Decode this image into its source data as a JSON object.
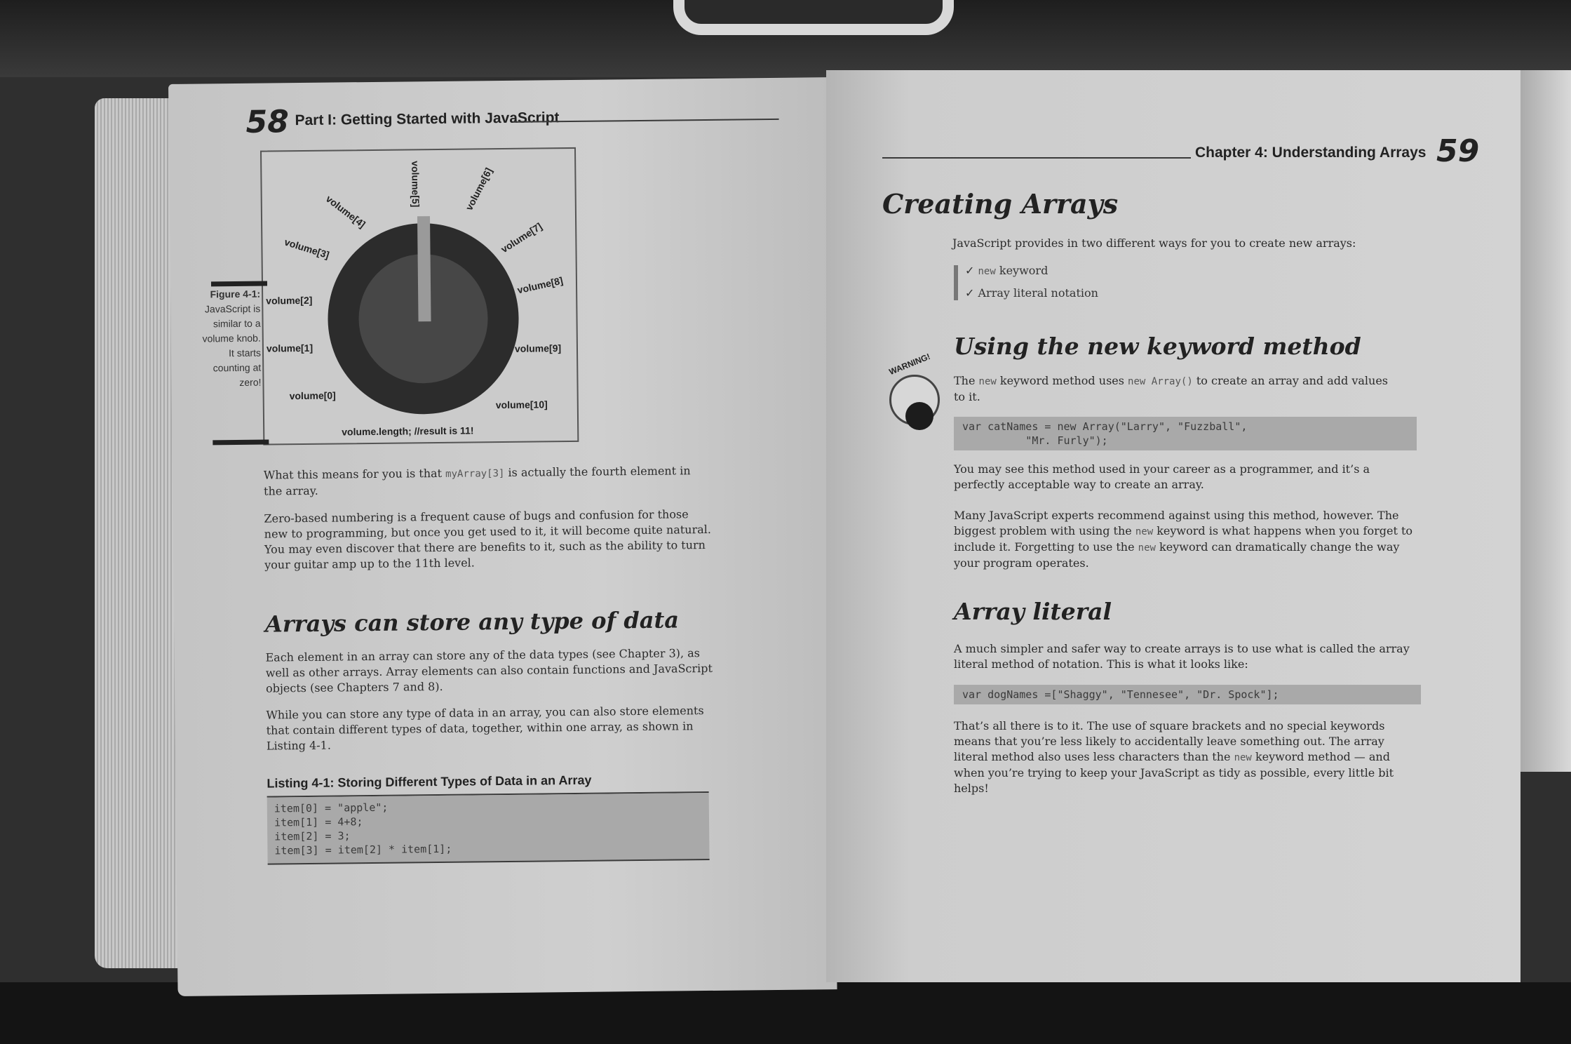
{
  "left_page": {
    "page_number": "58",
    "running_head": "Part I: Getting Started with JavaScript",
    "figure": {
      "labels": {
        "v0": "volume[0]",
        "v1": "volume[1]",
        "v2": "volume[2]",
        "v3": "volume[3]",
        "v4": "volume[4]",
        "v5": "volume[5]",
        "v6": "volume[6]",
        "v7": "volume[7]",
        "v8": "volume[8]",
        "v9": "volume[9]",
        "v10": "volume[10]"
      },
      "bottom_label": "volume.length; //result is 11!",
      "caption_title": "Figure 4-1:",
      "caption_body": "JavaScript is similar to a volume knob. It starts counting at zero!"
    },
    "para1_pre": "What this means for you is that ",
    "para1_code": "myArray[3]",
    "para1_post": " is actually the fourth element in the array.",
    "para2": "Zero-based numbering is a frequent cause of bugs and confusion for those new to programming, but once you get used to it, it will become quite natural. You may even discover that there are benefits to it, such as the ability to turn your guitar amp up to the 11th level.",
    "heading": "Arrays can store any type of data",
    "para3": "Each element in an array can store any of the data types (see Chapter 3), as well as other arrays. Array elements can also contain functions and JavaScript objects (see Chapters 7 and 8).",
    "para4": "While you can store any type of data in an array, you can also store elements that contain different types of data, together, within one array, as shown in Listing 4-1.",
    "listing_title": "Listing 4-1:   Storing Different Types of Data in an Array",
    "listing_code": "item[0] = \"apple\";\nitem[1] = 4+8;\nitem[2] = 3;\nitem[3] = item[2] * item[1];"
  },
  "right_page": {
    "running_head": "Chapter 4: Understanding Arrays",
    "page_number": "59",
    "heading1": "Creating Arrays",
    "intro": "JavaScript provides in two different ways for you to create new arrays:",
    "bullet1_code": "new",
    "bullet1_text": " keyword",
    "bullet2": "Array literal notation",
    "check": "✓",
    "heading2": "Using the new keyword method",
    "para1_a": "The ",
    "para1_code1": "new",
    "para1_b": " keyword method uses ",
    "para1_code2": "new Array()",
    "para1_c": " to create an array and add values to it.",
    "code1": "var catNames = new Array(\"Larry\", \"Fuzzball\",\n          \"Mr. Furly\");",
    "para2": "You may see this method used in your career as a programmer, and it’s a perfectly acceptable way to create an array.",
    "warning_label": "WARNING!",
    "warn_a": "Many JavaScript experts recommend against using this method, however. The biggest problem with using the ",
    "warn_code1": "new",
    "warn_b": " keyword is what happens when you forget to include it. Forgetting to use the ",
    "warn_code2": "new",
    "warn_c": " keyword can dramatically change the way your program operates.",
    "heading3": "Array literal",
    "para3": "A much simpler and safer way to create arrays is to use what is called the array literal method of notation. This is what it looks like:",
    "code2": "var dogNames =[\"Shaggy\", \"Tennesee\", \"Dr. Spock\"];",
    "para4_a": "That’s all there is to it. The use of square brackets and no special keywords means that you’re less likely to accidentally leave something out. The array literal method also uses less characters than the ",
    "para4_code": "new",
    "para4_b": " keyword method — and when you’re trying to keep your JavaScript as tidy as possible, every little bit helps!"
  }
}
